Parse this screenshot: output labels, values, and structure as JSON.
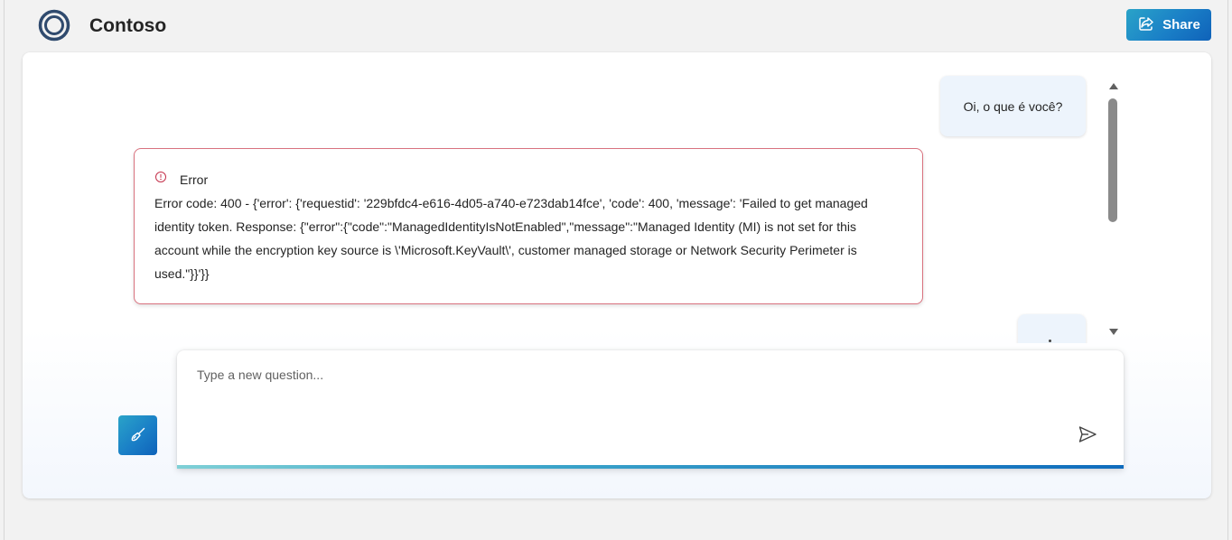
{
  "header": {
    "logo_icon": "contoso-ring-logo",
    "title": "Contoso",
    "share_label": "Share",
    "share_icon": "share-icon"
  },
  "messages": {
    "user_message_1": "Oi, o que é você?",
    "error": {
      "icon": "error-circle-icon",
      "title": "Error",
      "body": "Error code: 400 - {'error': {'requestid': '229bfdc4-e616-4d05-a740-e723dab14fce', 'code': 400, 'message': 'Failed to get managed identity token. Response: {\"error\":{\"code\":\"ManagedIdentityIsNotEnabled\",\"message\":\"Managed Identity (MI) is not set for this account while the encryption key source is \\'Microsoft.KeyVault\\', customer managed storage or Network Security Perimeter is used.\"}}'}}"
    }
  },
  "composer": {
    "placeholder": "Type a new question...",
    "clear_icon": "broom-icon",
    "send_icon": "send-icon"
  },
  "colors": {
    "accent_start": "#2aa3c8",
    "accent_end": "#0f62b9",
    "error_border": "#d9727f",
    "user_bubble": "#edf4fc"
  }
}
